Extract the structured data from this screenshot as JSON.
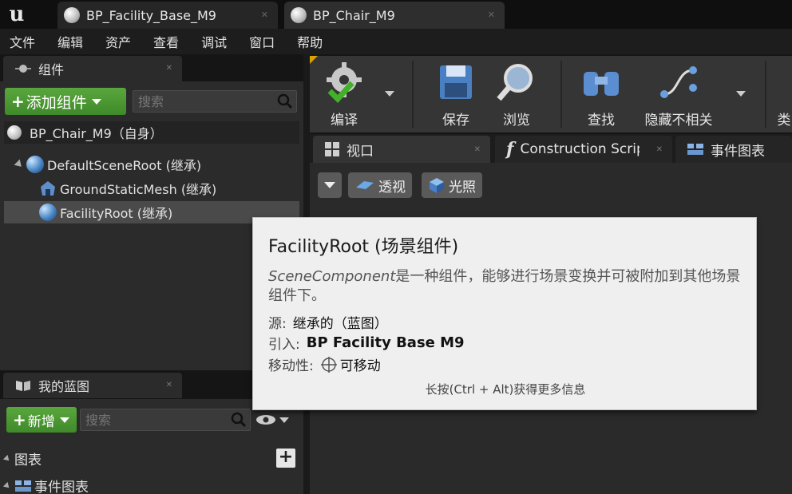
{
  "tabs": [
    {
      "label": "BP_Facility_Base_M9"
    },
    {
      "label": "BP_Chair_M9"
    }
  ],
  "menu": [
    "文件",
    "编辑",
    "资产",
    "查看",
    "调试",
    "窗口",
    "帮助"
  ],
  "components_panel": {
    "title": "组件",
    "add_button": "添加组件",
    "search_placeholder": "搜索",
    "self_row": "BP_Chair_M9（自身）",
    "tree": [
      {
        "label": "DefaultSceneRoot (继承)"
      },
      {
        "label": "GroundStaticMesh (继承)"
      },
      {
        "label": "FacilityRoot (继承)"
      }
    ]
  },
  "blueprint_panel": {
    "title": "我的蓝图",
    "new_button": "新增",
    "search_placeholder": "搜索",
    "sections": [
      {
        "label": "图表"
      },
      {
        "label": "事件图表"
      }
    ]
  },
  "toolbar": {
    "compile": "编译",
    "save": "保存",
    "browse": "浏览",
    "find": "查找",
    "hide_unrelated": "隐藏不相关",
    "more": "类"
  },
  "editor_tabs": [
    {
      "label": "视口"
    },
    {
      "label": "Construction Script"
    },
    {
      "label": "事件图表"
    }
  ],
  "viewport": {
    "perspective": "透视",
    "lighting": "光照"
  },
  "tooltip": {
    "title": "FacilityRoot (场景组件)",
    "desc_italic": "SceneComponent",
    "desc_rest": "是一种组件，能够进行场景变换并可被附加到其他场景组件下。",
    "source_key": "源:",
    "source_val": "继承的（蓝图）",
    "ref_key": "引入:",
    "ref_val": "BP Facility Base M9",
    "mobility_key": "移动性:",
    "mobility_val": "可移动",
    "hint": "长按(Ctrl + Alt)获得更多信息"
  },
  "colors": {
    "accent_green": "#4c9a33",
    "tooltip_bg": "#efefef",
    "panel_bg": "#2b2b2b"
  }
}
